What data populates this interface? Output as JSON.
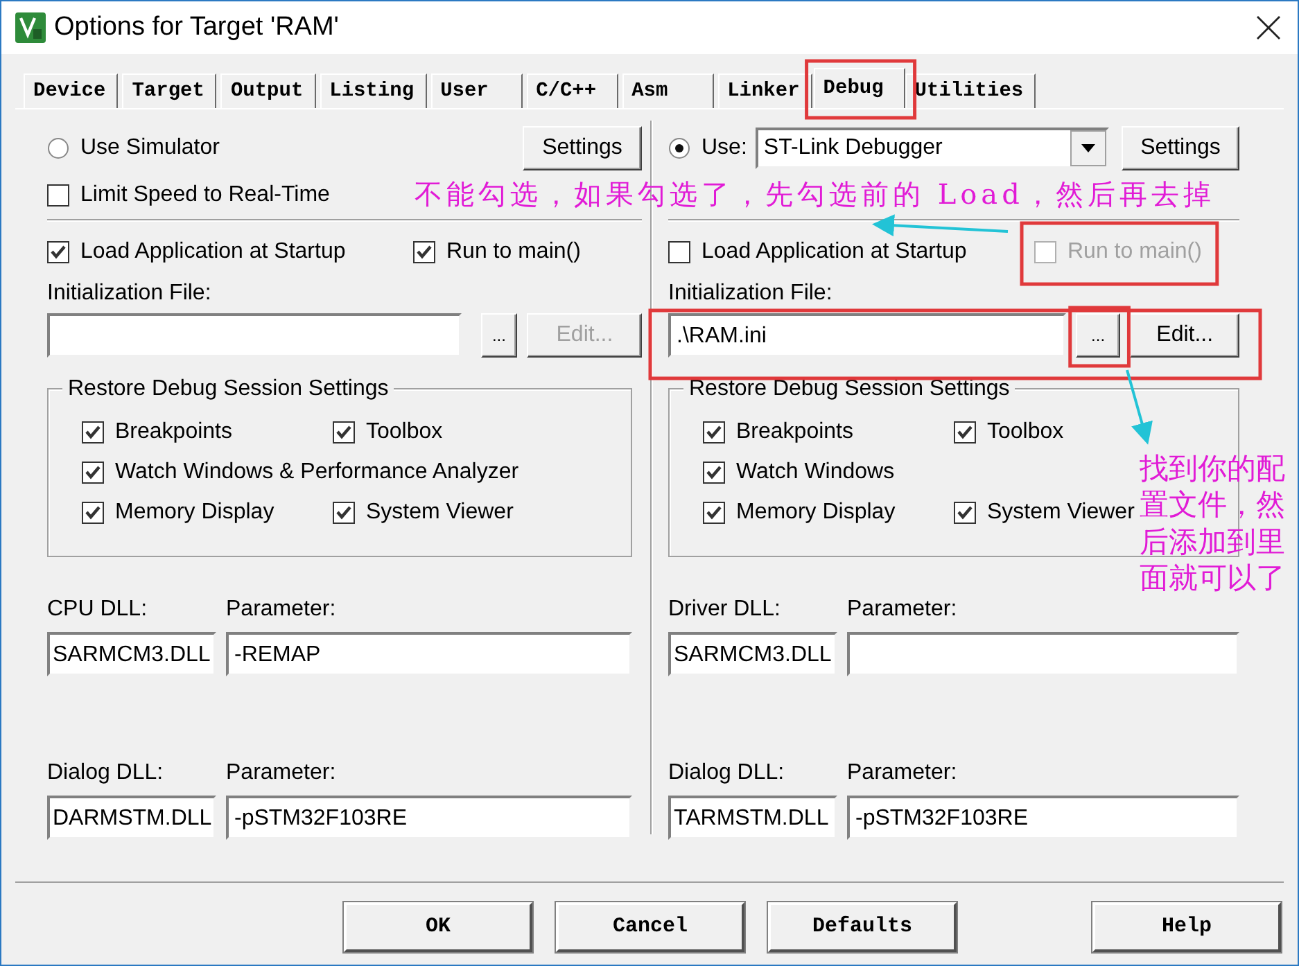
{
  "window": {
    "title": "Options for Target 'RAM'"
  },
  "tabs": [
    {
      "label": "Device",
      "selected": false
    },
    {
      "label": "Target",
      "selected": false
    },
    {
      "label": "Output",
      "selected": false
    },
    {
      "label": "Listing",
      "selected": false
    },
    {
      "label": "User",
      "selected": false
    },
    {
      "label": "C/C++",
      "selected": false
    },
    {
      "label": "Asm",
      "selected": false
    },
    {
      "label": "Linker",
      "selected": false
    },
    {
      "label": "Debug",
      "selected": true
    },
    {
      "label": "Utilities",
      "selected": false
    }
  ],
  "panes": [
    {
      "mode": {
        "label": "Use Simulator",
        "selected": false
      },
      "settings": "Settings",
      "limit_speed": {
        "label": "Limit Speed to Real-Time",
        "checked": false
      },
      "load_app": {
        "label": "Load Application at Startup",
        "checked": true
      },
      "run_to_main": {
        "label": "Run to main()",
        "checked": true,
        "disabled": false
      },
      "init_label": "Initialization File:",
      "browse": "...",
      "edit": {
        "label": "Edit...",
        "disabled": true
      },
      "restore": {
        "title": "Restore Debug Session Settings",
        "rows": [
          {
            "items": [
              {
                "label": "Breakpoints",
                "checked": true
              },
              {
                "label": "Toolbox",
                "checked": true
              }
            ]
          },
          {
            "items": [
              {
                "label": "Watch Windows & Performance Analyzer",
                "checked": true
              }
            ]
          },
          {
            "items": [
              {
                "label": "Memory Display",
                "checked": true
              },
              {
                "label": "System Viewer",
                "checked": true
              }
            ]
          }
        ]
      },
      "dll": [
        {
          "label": "CPU DLL:",
          "value": "SARMCM3.DLL",
          "param_label": "Parameter:",
          "param": "-REMAP"
        },
        {
          "label": "Dialog DLL:",
          "value": "DARMSTM.DLL",
          "param_label": "Parameter:",
          "param": "-pSTM32F103RE"
        }
      ]
    },
    {
      "mode": {
        "label": "Use:",
        "selected": true
      },
      "debugger": "ST-Link Debugger",
      "settings": "Settings",
      "load_app": {
        "label": "Load Application at Startup",
        "checked": false
      },
      "run_to_main": {
        "label": "Run to main()",
        "checked": false,
        "disabled": true
      },
      "init_label": "Initialization File:",
      "init_value": ".\\RAM.ini",
      "browse": "...",
      "edit": {
        "label": "Edit...",
        "disabled": false
      },
      "restore": {
        "title": "Restore Debug Session Settings",
        "rows": [
          {
            "items": [
              {
                "label": "Breakpoints",
                "checked": true
              },
              {
                "label": "Toolbox",
                "checked": true
              }
            ]
          },
          {
            "items": [
              {
                "label": "Watch Windows",
                "checked": true
              }
            ]
          },
          {
            "items": [
              {
                "label": "Memory Display",
                "checked": true
              },
              {
                "label": "System Viewer",
                "checked": true
              }
            ]
          }
        ]
      },
      "dll": [
        {
          "label": "Driver DLL:",
          "value": "SARMCM3.DLL",
          "param_label": "Parameter:"
        },
        {
          "label": "Dialog DLL:",
          "value": "TARMSTM.DLL",
          "param_label": "Parameter:",
          "param": "-pSTM32F103RE"
        }
      ]
    }
  ],
  "buttons": [
    "OK",
    "Cancel",
    "Defaults",
    "Help"
  ],
  "annotations": [
    {
      "kind": "note",
      "text": "不能勾选，如果勾选了，先勾选前的 Load，然后再去掉"
    },
    {
      "kind": "note",
      "text": "找到你的配置文件，然后添加到里面就可以了"
    }
  ]
}
